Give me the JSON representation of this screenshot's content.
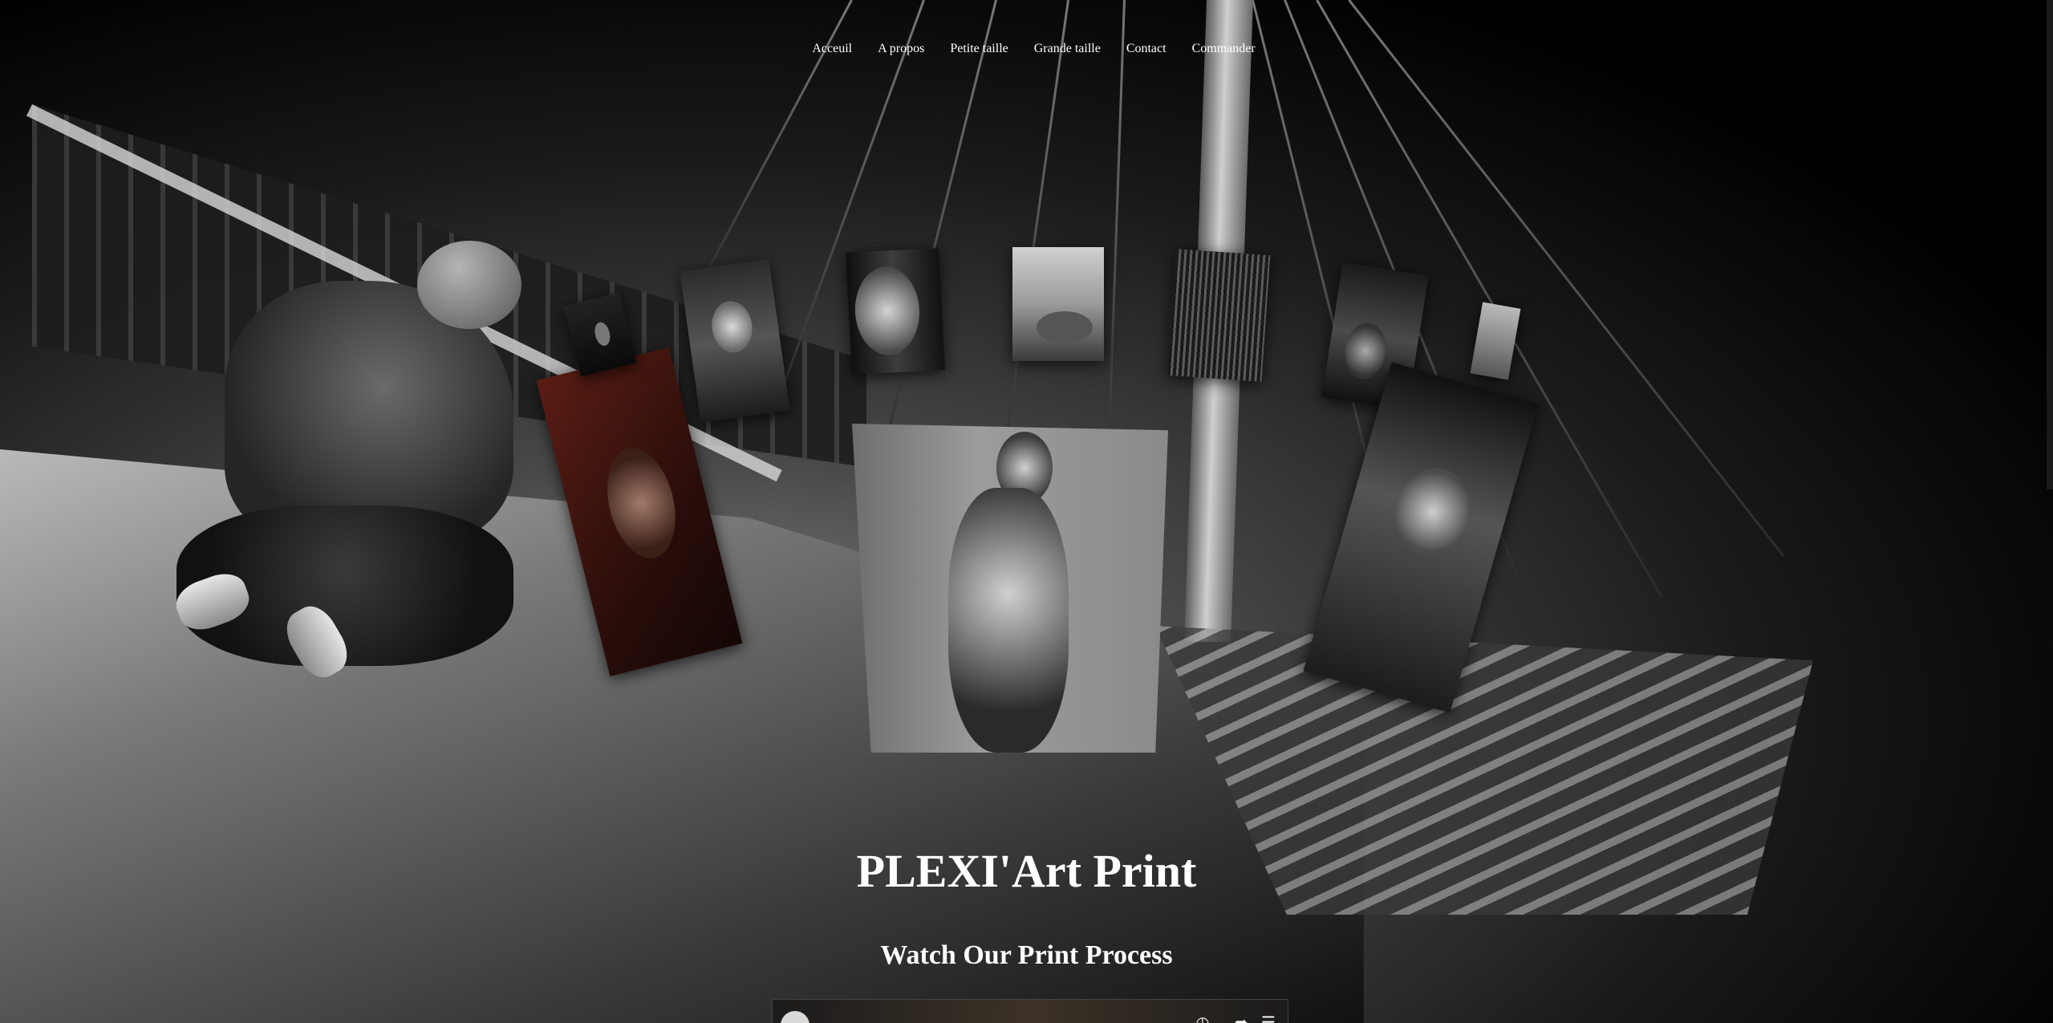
{
  "nav": {
    "items": [
      "Acceuil",
      "A propos",
      "Petite taille",
      "Grande taille",
      "Contact",
      "Commander"
    ]
  },
  "hero": {
    "brand": "PLEXI'Art Print",
    "subtitle": "Watch Our Print Process"
  },
  "video": {
    "title": "",
    "controls": [
      "clock-icon",
      "share-icon",
      "menu-icon"
    ]
  },
  "colors": {
    "text": "#ffffff",
    "background": "#000000"
  }
}
